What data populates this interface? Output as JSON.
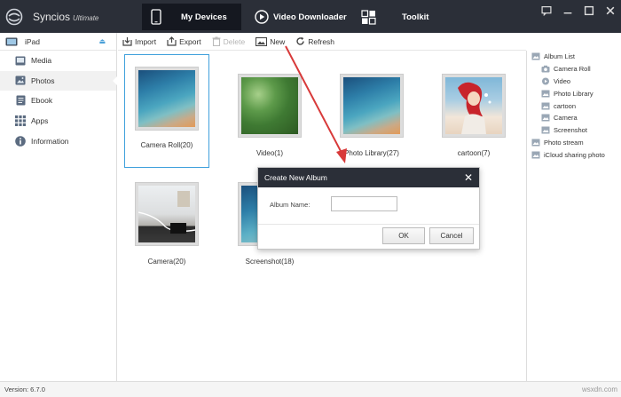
{
  "app": {
    "name": "Syncios",
    "edition": "Ultimate"
  },
  "nav": {
    "tabs": [
      {
        "label": "My Devices",
        "icon": "phone-icon"
      },
      {
        "label": "Video Downloader",
        "icon": "play-circle-icon"
      },
      {
        "label": "Toolkit",
        "icon": "grid-icon"
      }
    ]
  },
  "window_controls": [
    "message-icon",
    "minimize-icon",
    "maximize-icon",
    "close-icon"
  ],
  "sidebar": {
    "device": "iPad",
    "items": [
      {
        "label": "Media",
        "icon": "media-icon"
      },
      {
        "label": "Photos",
        "icon": "photos-icon"
      },
      {
        "label": "Ebook",
        "icon": "ebook-icon"
      },
      {
        "label": "Apps",
        "icon": "apps-icon"
      },
      {
        "label": "Information",
        "icon": "info-icon"
      }
    ]
  },
  "toolbar": {
    "import": "Import",
    "export": "Export",
    "delete": "Delete",
    "new": "New",
    "refresh": "Refresh"
  },
  "albums": [
    {
      "label": "Camera Roll(20)"
    },
    {
      "label": "Video(1)"
    },
    {
      "label": "Photo Library(27)"
    },
    {
      "label": "cartoon(7)"
    },
    {
      "label": "Camera(20)"
    },
    {
      "label": "Screenshot(18)"
    }
  ],
  "album_tree": {
    "root": "Album List",
    "children": [
      "Camera Roll",
      "Video",
      "Photo Library",
      "cartoon",
      "Camera",
      "Screenshot"
    ],
    "others": [
      "Photo stream",
      "iCloud sharing photo"
    ]
  },
  "dialog": {
    "title": "Create New Album",
    "label": "Album Name:",
    "value": "",
    "ok": "OK",
    "cancel": "Cancel"
  },
  "status": {
    "version": "Version: 6.7.0",
    "watermark": "wsxdn.com"
  },
  "colors": {
    "topbar": "#2b2f38",
    "accent": "#3fa0dc",
    "arrow": "#d83a3a"
  }
}
